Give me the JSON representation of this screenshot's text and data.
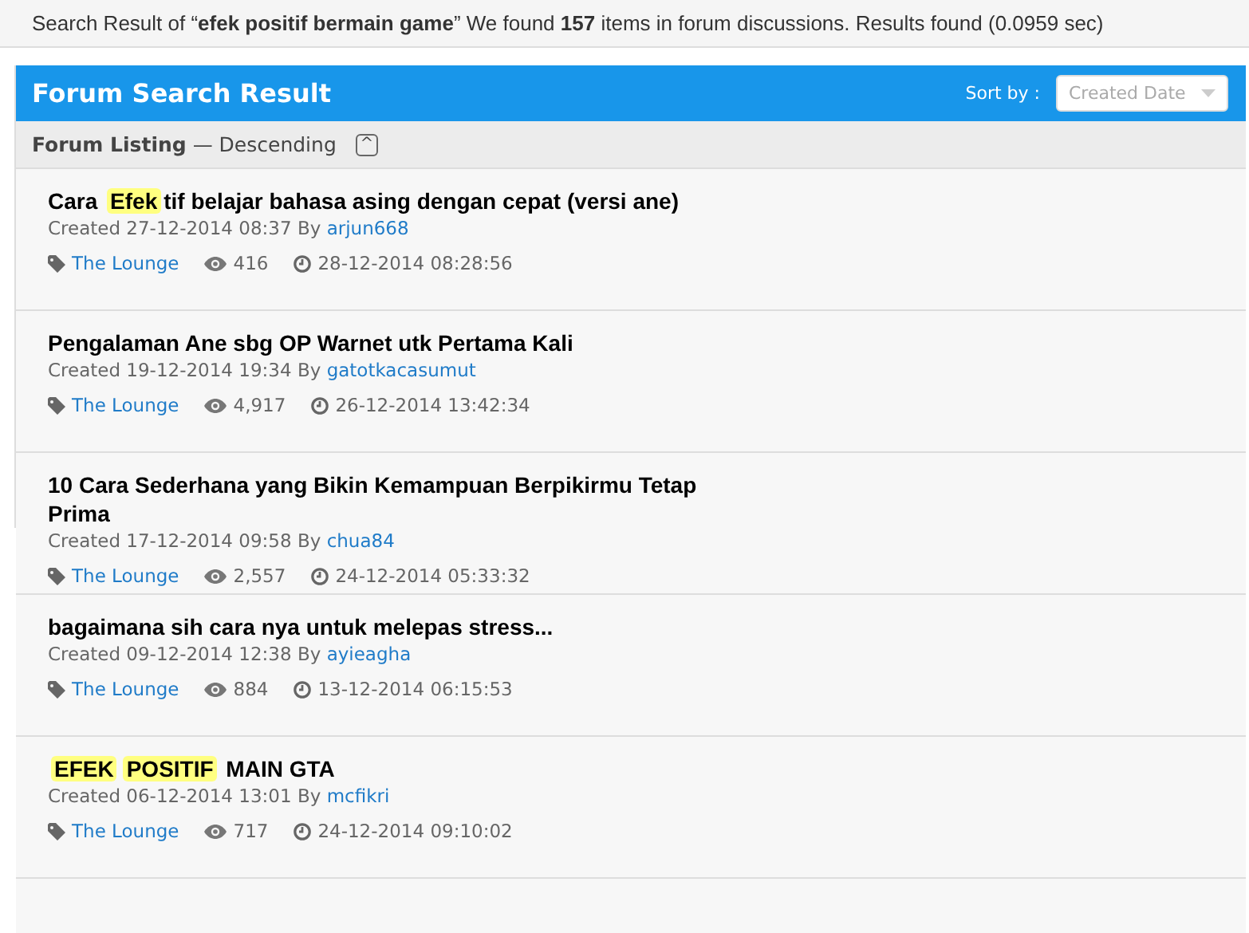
{
  "search_summary": {
    "prefix": "Search Result of “",
    "query": "efek positif bermain game",
    "middle": "” We found ",
    "count": "157",
    "suffix": " items in forum discussions. Results found (0.0959 sec)"
  },
  "panel": {
    "title": "Forum Search Result",
    "sort_label": "Sort by :",
    "sort_value": "Created Date"
  },
  "listing": {
    "label": "Forum Listing",
    "order": "— Descending",
    "collapse_icon": "^"
  },
  "threads": [
    {
      "title": [
        {
          "text": "Cara ",
          "highlight": false
        },
        {
          "text": "Efek",
          "highlight": true
        },
        {
          "text": "tif belajar bahasa asing dengan cepat (versi ane)",
          "highlight": false
        }
      ],
      "created": "Created 27-12-2014 08:37 By",
      "author": "arjun668",
      "category": "The Lounge",
      "views": "416",
      "last_post": "28-12-2014 08:28:56"
    },
    {
      "title": [
        {
          "text": "Pengalaman Ane sbg OP Warnet utk Pertama Kali",
          "highlight": false
        }
      ],
      "created": "Created 19-12-2014 19:34 By",
      "author": "gatotkacasumut",
      "category": "The Lounge",
      "views": "4,917",
      "last_post": "26-12-2014 13:42:34"
    },
    {
      "title": [
        {
          "text": "10 Cara Sederhana yang Bikin Kemampuan Berpikirmu Tetap Prima",
          "highlight": false
        }
      ],
      "created": "Created 17-12-2014 09:58 By",
      "author": "chua84",
      "category": "The Lounge",
      "views": "2,557",
      "last_post": "24-12-2014 05:33:32"
    },
    {
      "title": [
        {
          "text": "bagaimana sih cara nya untuk melepas stress...",
          "highlight": false
        }
      ],
      "created": "Created 09-12-2014 12:38 By",
      "author": "ayieagha",
      "category": "The Lounge",
      "views": "884",
      "last_post": "13-12-2014 06:15:53"
    },
    {
      "title": [
        {
          "text": "EFEK",
          "highlight": true
        },
        {
          "text": "POSITIF",
          "highlight": true
        },
        {
          "text": " MAIN GTA",
          "highlight": false
        }
      ],
      "created": "Created 06-12-2014 13:01 By",
      "author": "mcfikri",
      "category": "The Lounge",
      "views": "717",
      "last_post": "24-12-2014 09:10:02"
    }
  ]
}
